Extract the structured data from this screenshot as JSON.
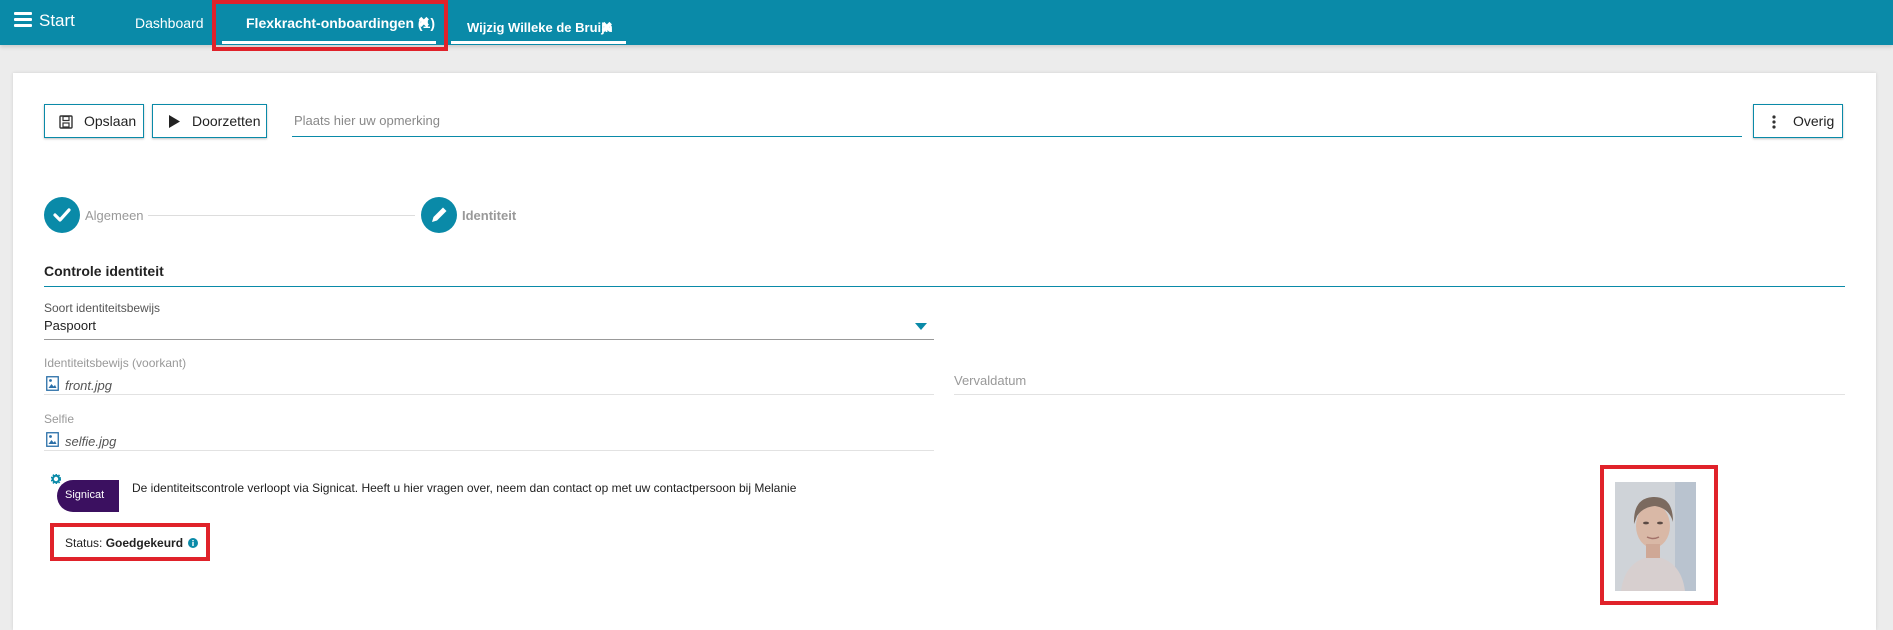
{
  "topbar": {
    "brand": "Start",
    "tabs": [
      {
        "label": "Dashboard"
      },
      {
        "label": "Flexkracht-onboardingen (1)",
        "close": "✖"
      },
      {
        "label": "Wijzig Willeke de Bruijn",
        "close": "✖"
      }
    ]
  },
  "toolbar": {
    "save_label": "Opslaan",
    "forward_label": "Doorzetten",
    "remark_placeholder": "Plaats hier uw opmerking",
    "more_label": "Overig"
  },
  "stepper": {
    "steps": [
      {
        "label": "Algemeen",
        "icon": "check-icon"
      },
      {
        "label": "Identiteit",
        "icon": "pencil-icon"
      }
    ]
  },
  "form": {
    "section_title": "Controle identiteit",
    "id_type_label": "Soort identiteitsbewijs",
    "id_type_value": "Paspoort",
    "front_label": "Identiteitsbewijs (voorkant)",
    "front_file": "front.jpg",
    "expiry_label": "Vervaldatum",
    "selfie_label": "Selfie",
    "selfie_file": "selfie.jpg"
  },
  "signicat": {
    "logo_text": "Signicat",
    "info_text": "De identiteitscontrole verloopt via Signicat. Heeft u hier vragen over, neem dan contact op met uw contactpersoon bij Melanie",
    "status_label": "Status:",
    "status_value": "Goedgekeurd"
  },
  "colors": {
    "accent": "#0a8aa8",
    "highlight": "#e0222a",
    "signicat_purple": "#3b1060"
  }
}
